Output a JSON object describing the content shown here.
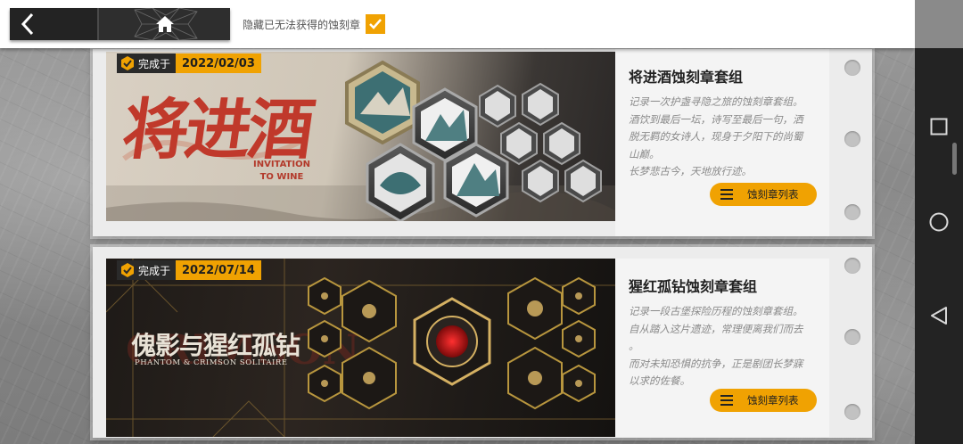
{
  "topbar": {
    "back_icon": "chevron-left-icon",
    "home_icon": "home-icon",
    "hide_label": "隐藏已无法获得的蚀刻章",
    "hide_checked": true
  },
  "colors": {
    "accent": "#f0a202",
    "dark": "#232323"
  },
  "cards": [
    {
      "done_label": "完成于",
      "date": "2022/02/03",
      "logo_cn": "将进酒",
      "logo_en_line1": "INVITATION",
      "logo_en_line2": "TO WINE",
      "title": "将进酒蚀刻章套组",
      "desc": [
        "记录一次护盏寻隐之旅的蚀刻章套组。",
        "酒饮到最后一坛，诗写至最后一句，洒",
        "脱无羁的女诗人，现身于夕阳下的尚蜀",
        "山巅。",
        "长梦悲古今，天地放行迹。"
      ],
      "button": "蚀刻章列表"
    },
    {
      "done_label": "完成于",
      "date": "2022/07/14",
      "logo_cn": "傀影与猩红孤钻",
      "logo_en": "PHANTOM & CRIMSON SOLITAIRE",
      "logo_bg": "CRIMSON",
      "title": "猩红孤钻蚀刻章套组",
      "desc": [
        "记录一段古堡探险历程的蚀刻章套组。",
        "自从踏入这片遗迹，常理便离我们而去",
        "。",
        "而对未知恐惧的抗争，正是剧团长梦寐",
        "以求的佐餐。"
      ],
      "button": "蚀刻章列表"
    }
  ],
  "system_nav": {
    "recent_icon": "square-icon",
    "home_icon": "circle-icon",
    "back_icon": "triangle-back-icon"
  }
}
